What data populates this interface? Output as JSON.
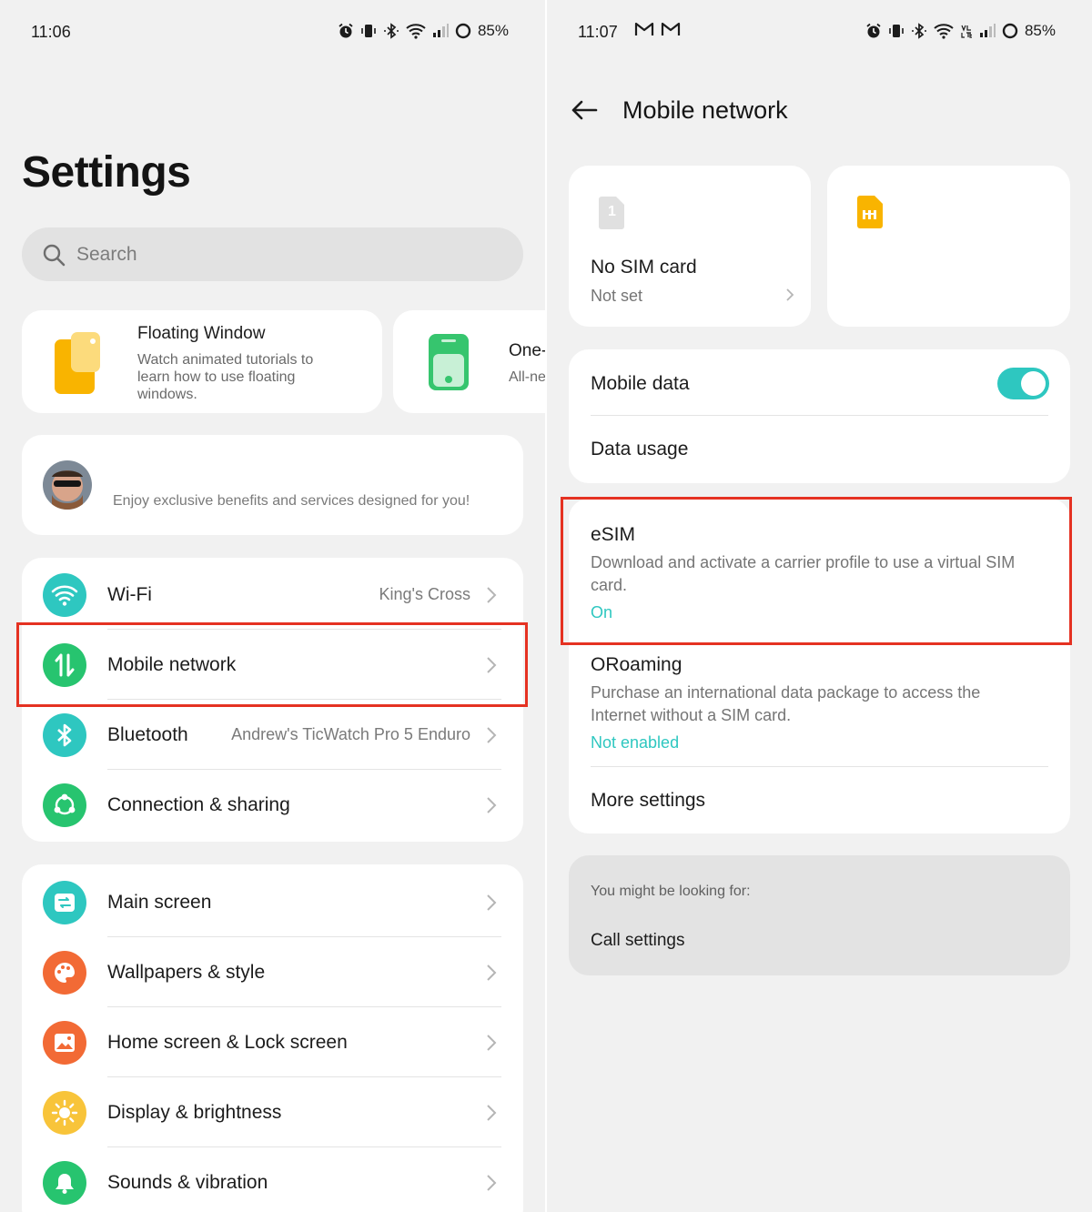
{
  "left": {
    "status": {
      "time": "11:06",
      "battery": "85%"
    },
    "title": "Settings",
    "search": {
      "placeholder": "Search"
    },
    "tips": [
      {
        "title": "Floating Window",
        "body": "Watch animated tutorials to learn how to use floating windows."
      },
      {
        "title": "One-",
        "body": "All-ne"
      }
    ],
    "account": {
      "promo": "Enjoy exclusive benefits and services designed for you!"
    },
    "connectivity": [
      {
        "label": "Wi-Fi",
        "value": "King's Cross",
        "icon": "wifi-icon",
        "color": "#2ec7c0"
      },
      {
        "label": "Mobile network",
        "value": "",
        "icon": "mobile-data-icon",
        "color": "#27c46f"
      },
      {
        "label": "Bluetooth",
        "value": "Andrew's TicWatch Pro 5 Enduro",
        "icon": "bluetooth-icon",
        "color": "#2ec7c0"
      },
      {
        "label": "Connection & sharing",
        "value": "",
        "icon": "share-icon",
        "color": "#27c46f"
      }
    ],
    "personalization": [
      {
        "label": "Main screen",
        "icon": "main-screen-icon",
        "color": "#2ec7c0"
      },
      {
        "label": "Wallpapers & style",
        "icon": "palette-icon",
        "color": "#f26a35"
      },
      {
        "label": "Home screen & Lock screen",
        "icon": "image-icon",
        "color": "#f26a35"
      },
      {
        "label": "Display & brightness",
        "icon": "sun-icon",
        "color": "#f8c43a"
      },
      {
        "label": "Sounds & vibration",
        "icon": "bell-icon",
        "color": "#27c46f"
      }
    ]
  },
  "right": {
    "status": {
      "time": "11:07",
      "battery": "85%"
    },
    "title": "Mobile network",
    "sim1": {
      "badge": "1",
      "title": "No SIM card",
      "sub": "Not set"
    },
    "mobile_data": {
      "label": "Mobile data",
      "enabled": true
    },
    "data_usage": {
      "label": "Data usage"
    },
    "esim": {
      "title": "eSIM",
      "desc": "Download and activate a carrier profile to use a virtual SIM card.",
      "status": "On"
    },
    "oroaming": {
      "title": "ORoaming",
      "desc": "Purchase an international data package to access the Internet without a SIM card.",
      "status": "Not enabled"
    },
    "more_settings": {
      "label": "More settings"
    },
    "suggest": {
      "heading": "You might be looking for:",
      "item": "Call settings"
    },
    "accent": "#2ec7c0",
    "highlight": "#e53222"
  }
}
